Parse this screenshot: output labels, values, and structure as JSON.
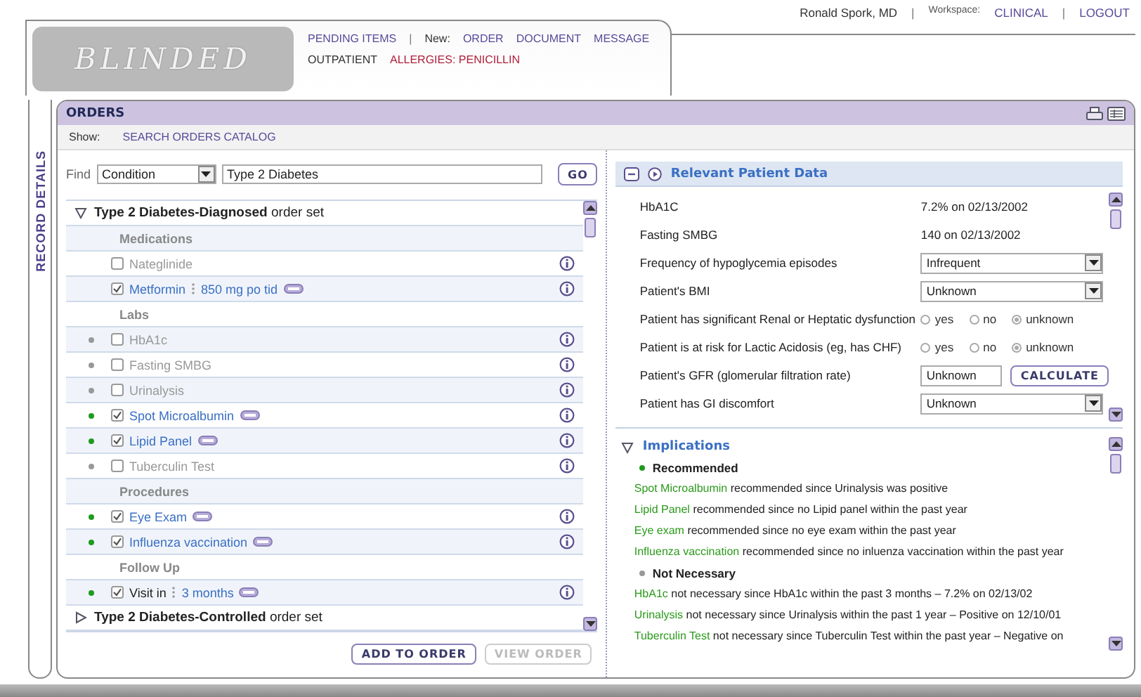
{
  "header": {
    "logo": "BLINDED",
    "nav": [
      {
        "label": "PENDING ITEMS",
        "kind": "link"
      },
      {
        "label": "|",
        "kind": "sep"
      },
      {
        "label": "New:",
        "kind": "label"
      },
      {
        "label": "ORDER",
        "kind": "link"
      },
      {
        "label": "DOCUMENT",
        "kind": "link"
      },
      {
        "label": "MESSAGE",
        "kind": "link"
      }
    ],
    "context": [
      {
        "label": "OUTPATIENT",
        "kind": "label"
      },
      {
        "label": "ALLERGIES: PENICILLIN",
        "kind": "alert"
      }
    ],
    "user": [
      {
        "label": "Ronald Spork, MD",
        "kind": "label"
      },
      {
        "label": "|",
        "kind": "sep"
      },
      {
        "label": "Workspace:",
        "kind": "small"
      },
      {
        "label": "CLINICAL",
        "kind": "link"
      },
      {
        "label": "|",
        "kind": "sep"
      },
      {
        "label": "LOGOUT",
        "kind": "link"
      }
    ]
  },
  "rail": {
    "label": "RECORD DETAILS"
  },
  "orders": {
    "title": "ORDERS",
    "show_label": "Show:",
    "show_link": "SEARCH ORDERS CATALOG",
    "find": {
      "label": "Find",
      "category": "Condition",
      "query": "Type 2 Diabetes",
      "button": "GO"
    },
    "order_sets": [
      {
        "title": "Type 2 Diabetes-Diagnosed",
        "suffix": "order set",
        "expanded": true,
        "groups": [
          {
            "name": "Medications",
            "items": [
              {
                "kind": "order",
                "name": "Nateglinide",
                "checked": false
              },
              {
                "kind": "order",
                "name": "Metformin",
                "detail": "850 mg po tid",
                "checked": true
              }
            ]
          },
          {
            "name": "Labs",
            "items": [
              {
                "kind": "order",
                "name": "HbA1c",
                "checked": false,
                "color": "#999999"
              },
              {
                "kind": "order",
                "name": "Fasting SMBG",
                "checked": false,
                "color": "#999999"
              },
              {
                "kind": "order",
                "name": "Urinalysis",
                "checked": false,
                "color": "#999999"
              },
              {
                "kind": "order",
                "name": "Spot Microalbumin",
                "checked": true,
                "color": "#1f9a1f"
              },
              {
                "kind": "order",
                "name": "Lipid Panel",
                "checked": true,
                "color": "#1f9a1f"
              },
              {
                "kind": "order",
                "name": "Tuberculin Test",
                "checked": false,
                "color": "#999999"
              }
            ]
          },
          {
            "name": "Procedures",
            "items": [
              {
                "kind": "order",
                "name": "Eye Exam",
                "checked": true,
                "color": "#1f9a1f"
              },
              {
                "kind": "order",
                "name": "Influenza vaccination",
                "checked": true,
                "color": "#1f9a1f"
              }
            ]
          },
          {
            "name": "Follow Up",
            "items": [
              {
                "kind": "followup",
                "name": "Visit in",
                "detail": "3 months",
                "checked": true,
                "color": "#1f9a1f"
              }
            ]
          }
        ]
      },
      {
        "title": "Type 2 Diabetes-Controlled",
        "suffix": "order set",
        "expanded": false
      }
    ],
    "buttons": [
      {
        "label": "ADD TO ORDER",
        "disabled": false
      },
      {
        "label": "VIEW ORDER",
        "disabled": true
      }
    ]
  },
  "patient_data": {
    "title": "Relevant Patient Data",
    "expanded": true,
    "rows": [
      {
        "kind": "value",
        "label": "HbA1C",
        "value": "7.2% on 02/13/2002"
      },
      {
        "kind": "value",
        "label": "Fasting SMBG",
        "value": "140 on 02/13/2002"
      },
      {
        "kind": "select",
        "label": "Frequency of hypoglycemia episodes",
        "value": "Infrequent"
      },
      {
        "kind": "select",
        "label": "Patient's BMI",
        "value": "Unknown"
      },
      {
        "kind": "radio",
        "label": "Patient has significant Renal or Heptatic dysfunction",
        "options": [
          {
            "label": "yes",
            "selected": false
          },
          {
            "label": "no",
            "selected": false
          },
          {
            "label": "unknown",
            "selected": true
          }
        ]
      },
      {
        "kind": "radio",
        "label": "Patient is at risk for Lactic Acidosis (eg, has CHF)",
        "options": [
          {
            "label": "yes",
            "selected": false
          },
          {
            "label": "no",
            "selected": false
          },
          {
            "label": "unknown",
            "selected": true
          }
        ]
      },
      {
        "kind": "input",
        "label": "Patient's GFR (glomerular filtration rate)",
        "value": "Unknown",
        "button": "CALCULATE"
      },
      {
        "kind": "select",
        "label": "Patient has GI discomfort",
        "value": "Unknown"
      }
    ]
  },
  "implications": {
    "title": "Implications",
    "expanded": true,
    "groups": [
      {
        "title": "Recommended",
        "color": "#1f9a1f",
        "lines": [
          {
            "item": "Spot Microalbumin",
            "reason": "recommended since Urinalysis was positive"
          },
          {
            "item": "Lipid Panel",
            "reason": "recommended since no Lipid panel within the past year"
          },
          {
            "item": "Eye exam",
            "reason": "recommended since no eye exam within the past year"
          },
          {
            "item": "Influenza vaccination",
            "reason": "recommended since no inluenza vaccination within the past year"
          }
        ]
      },
      {
        "title": "Not Necessary",
        "color": "#999999",
        "lines": [
          {
            "item": "HbA1c",
            "reason": "not necessary since HbA1c within the past 3 months – 7.2% on 02/13/02"
          },
          {
            "item": "Urinalysis",
            "reason": "not necessary since Urinalysis within the past 1 year – Positive on 12/10/01"
          },
          {
            "item": "Tuberculin Test",
            "reason": "not necessary since Tuberculin Test within the past year – Negative on"
          }
        ]
      }
    ]
  }
}
